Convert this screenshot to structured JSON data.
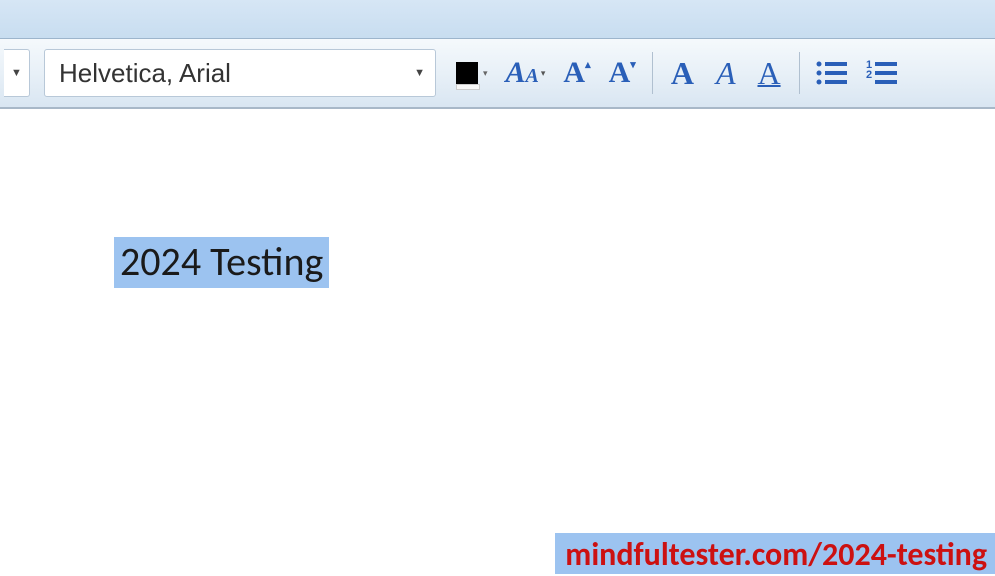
{
  "toolbar": {
    "font_name": "Helvetica, Arial",
    "color": "#000000"
  },
  "document": {
    "selected_text": "2024 Testing"
  },
  "watermark": {
    "text": "mindfultester.com/2024-testing"
  }
}
